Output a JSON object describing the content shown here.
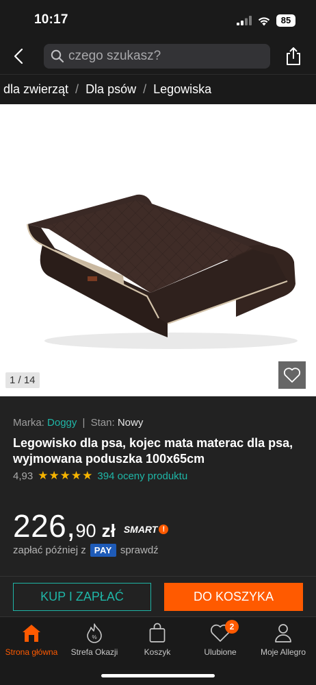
{
  "status_bar": {
    "time": "10:17",
    "battery": "85"
  },
  "search": {
    "placeholder": "czego szukasz?"
  },
  "breadcrumb": [
    "dla zwierząt",
    "Dla psów",
    "Legowiska"
  ],
  "gallery": {
    "counter": "1 / 14",
    "bed_color": "#3b2a26",
    "piping_color": "#cdbba3"
  },
  "product": {
    "brand_label": "Marka:",
    "brand": "Doggy",
    "separator": "|",
    "condition_label": "Stan:",
    "condition": "Nowy",
    "title": "Legowisko dla psa, kojec mata materac dla psa, wyjmowana poduszka 100x65cm",
    "rating": "4,93",
    "stars": "★★★★★",
    "reviews": "394 oceny produktu",
    "price_int": "226,",
    "price_dec": "90",
    "currency": "zł",
    "smart": "SMART",
    "pay_later_prefix": "zapłać później z",
    "pay_badge": "PAY",
    "pay_check": "sprawdź"
  },
  "actions": {
    "buy_now": "KUP I ZAPŁAĆ",
    "add_to_cart": "DO KOSZYKA"
  },
  "bottom_nav": [
    {
      "label": "Strona główna",
      "icon": "home-icon",
      "active": true
    },
    {
      "label": "Strefa Okazji",
      "icon": "deals-icon",
      "active": false
    },
    {
      "label": "Koszyk",
      "icon": "cart-bag-icon",
      "active": false
    },
    {
      "label": "Ulubione",
      "icon": "heart-icon",
      "active": false,
      "badge": "2"
    },
    {
      "label": "Moje Allegro",
      "icon": "user-icon",
      "active": false
    }
  ],
  "colors": {
    "accent_orange": "#ff5a00",
    "accent_teal": "#1fb6a7",
    "star_yellow": "#f6b400",
    "pay_blue": "#1e5bb8",
    "background": "#1a1a1a"
  }
}
